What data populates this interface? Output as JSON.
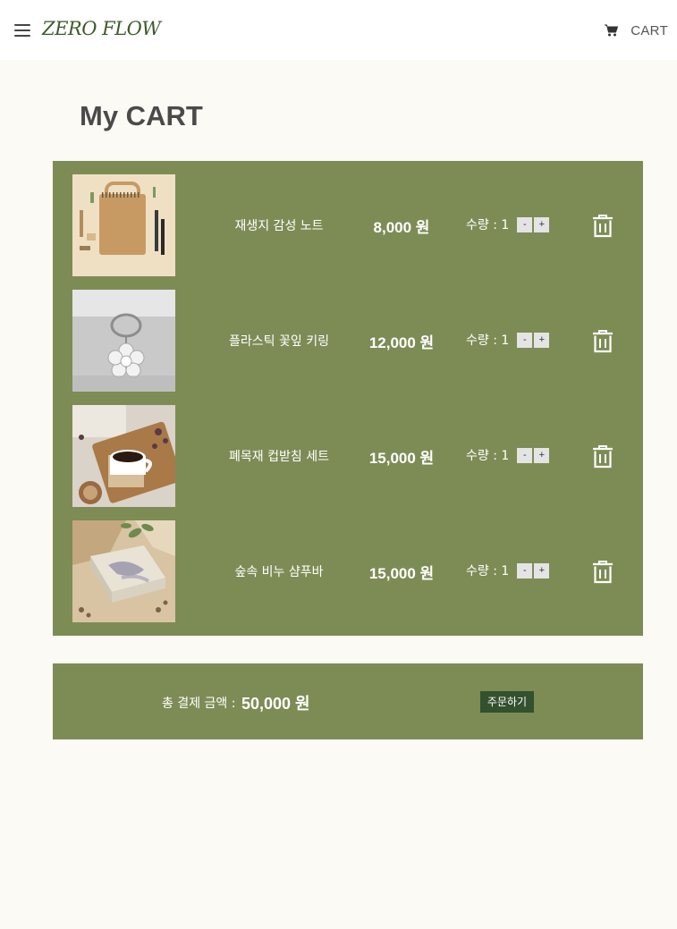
{
  "header": {
    "logo_text": "ZERO FLOW",
    "menu_icon": "hamburger-menu-icon",
    "cart_icon": "shopping-cart-icon",
    "cart_label": "CART"
  },
  "page": {
    "title": "My CART"
  },
  "cart": {
    "quantity_prefix": "수량 : ",
    "minus_label": "-",
    "plus_label": "+",
    "delete_icon": "trash-icon",
    "items": [
      {
        "name": "재생지 감성 노트",
        "price": "8,000 원",
        "quantity_text": "수량 : 1"
      },
      {
        "name": "플라스틱 꽃잎 키링",
        "price": "12,000 원",
        "quantity_text": "수량 : 1"
      },
      {
        "name": "폐목재 컵받침 세트",
        "price": "15,000 원",
        "quantity_text": "수량 : 1"
      },
      {
        "name": "숲속 비누 샴푸바",
        "price": "15,000 원",
        "quantity_text": "수량 : 1"
      }
    ]
  },
  "summary": {
    "total_label": "총 결제 금액 :",
    "total_amount": "50,000 원",
    "order_button_label": "주문하기"
  },
  "colors": {
    "panel_green": "#7d8c55",
    "order_button": "#33502f",
    "page_background": "#fbfaf5",
    "logo_green": "#3d5a2a"
  }
}
